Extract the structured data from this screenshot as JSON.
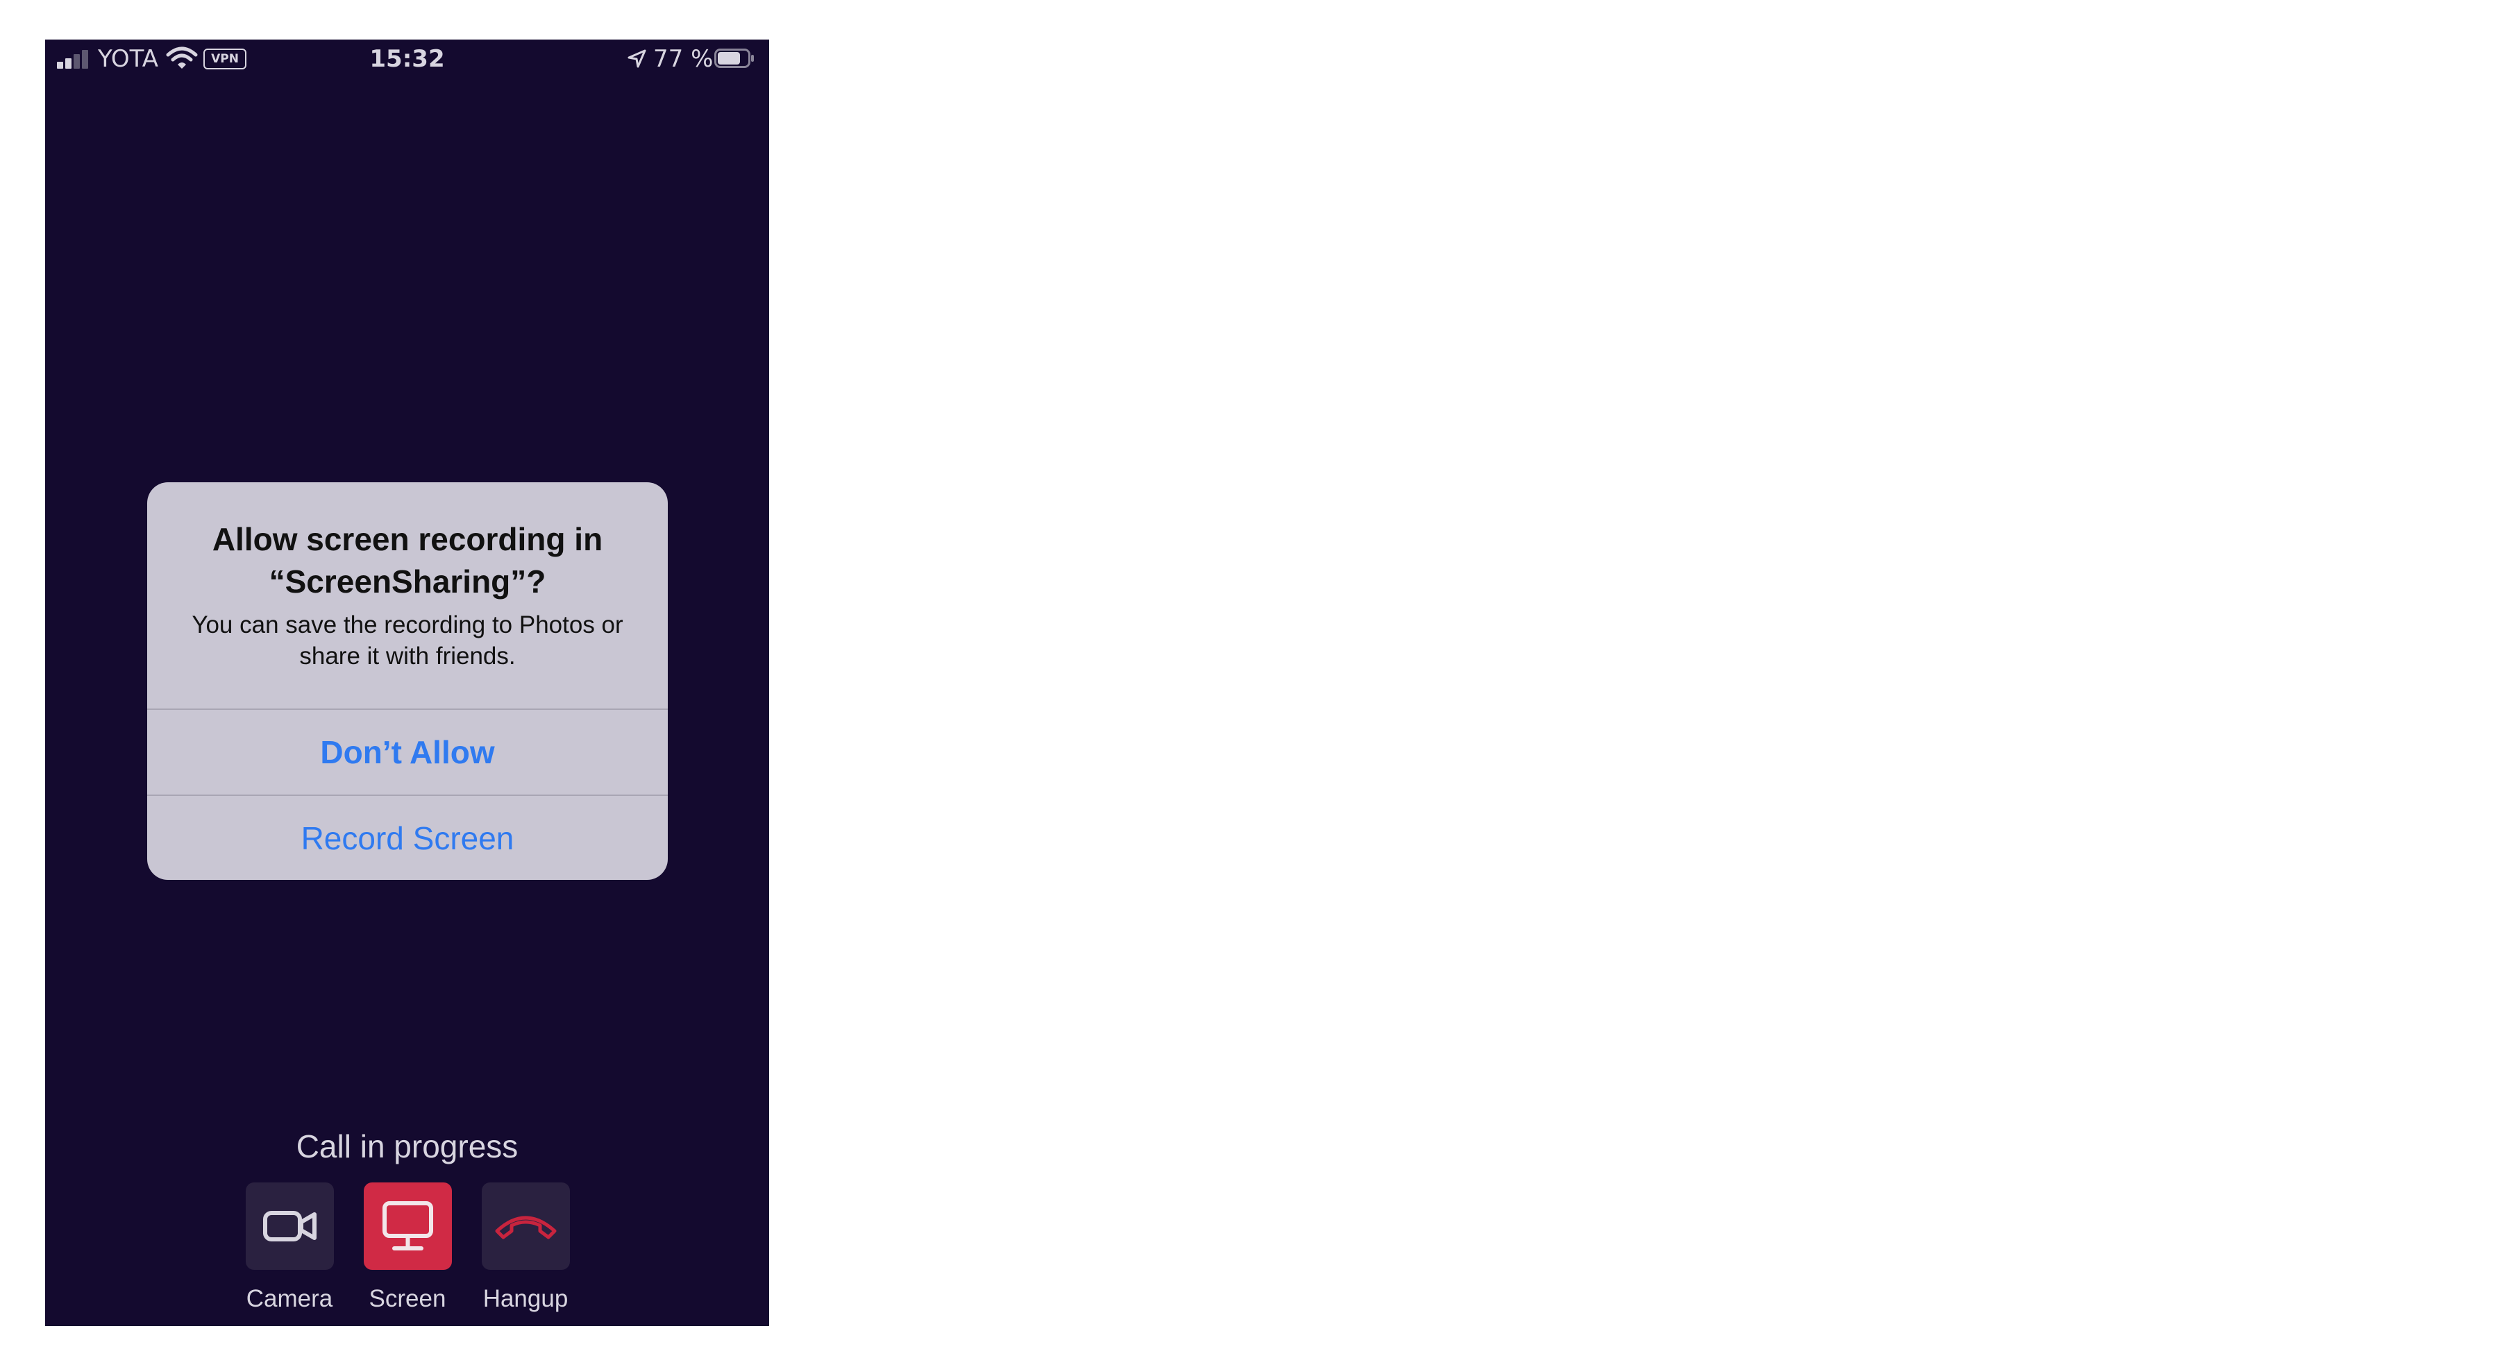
{
  "status_bar": {
    "carrier": "YOTA",
    "vpn_badge": "VPN",
    "time": "15:32",
    "battery_percent": "77 %",
    "battery_level": 0.77,
    "signal_bars_active": 2,
    "signal_bars_total": 4
  },
  "alert": {
    "title": "Allow screen recording in “ScreenSharing”?",
    "message": "You can save the recording to Photos or share it with friends.",
    "buttons": [
      {
        "label": "Don’t Allow"
      },
      {
        "label": "Record Screen"
      }
    ]
  },
  "call": {
    "status": "Call in progress",
    "controls": [
      {
        "label": "Camera",
        "icon": "video-camera-icon"
      },
      {
        "label": "Screen",
        "icon": "monitor-icon"
      },
      {
        "label": "Hangup",
        "icon": "hangup-phone-icon"
      }
    ]
  },
  "colors": {
    "background": "#140a2f",
    "alert_background": "#c9c6d3",
    "alert_button_text": "#2f7af0",
    "control_background": "#2a2140",
    "screen_active": "#d02a45",
    "hangup_icon": "#c8243e",
    "icon_light": "#d8d5e0"
  }
}
